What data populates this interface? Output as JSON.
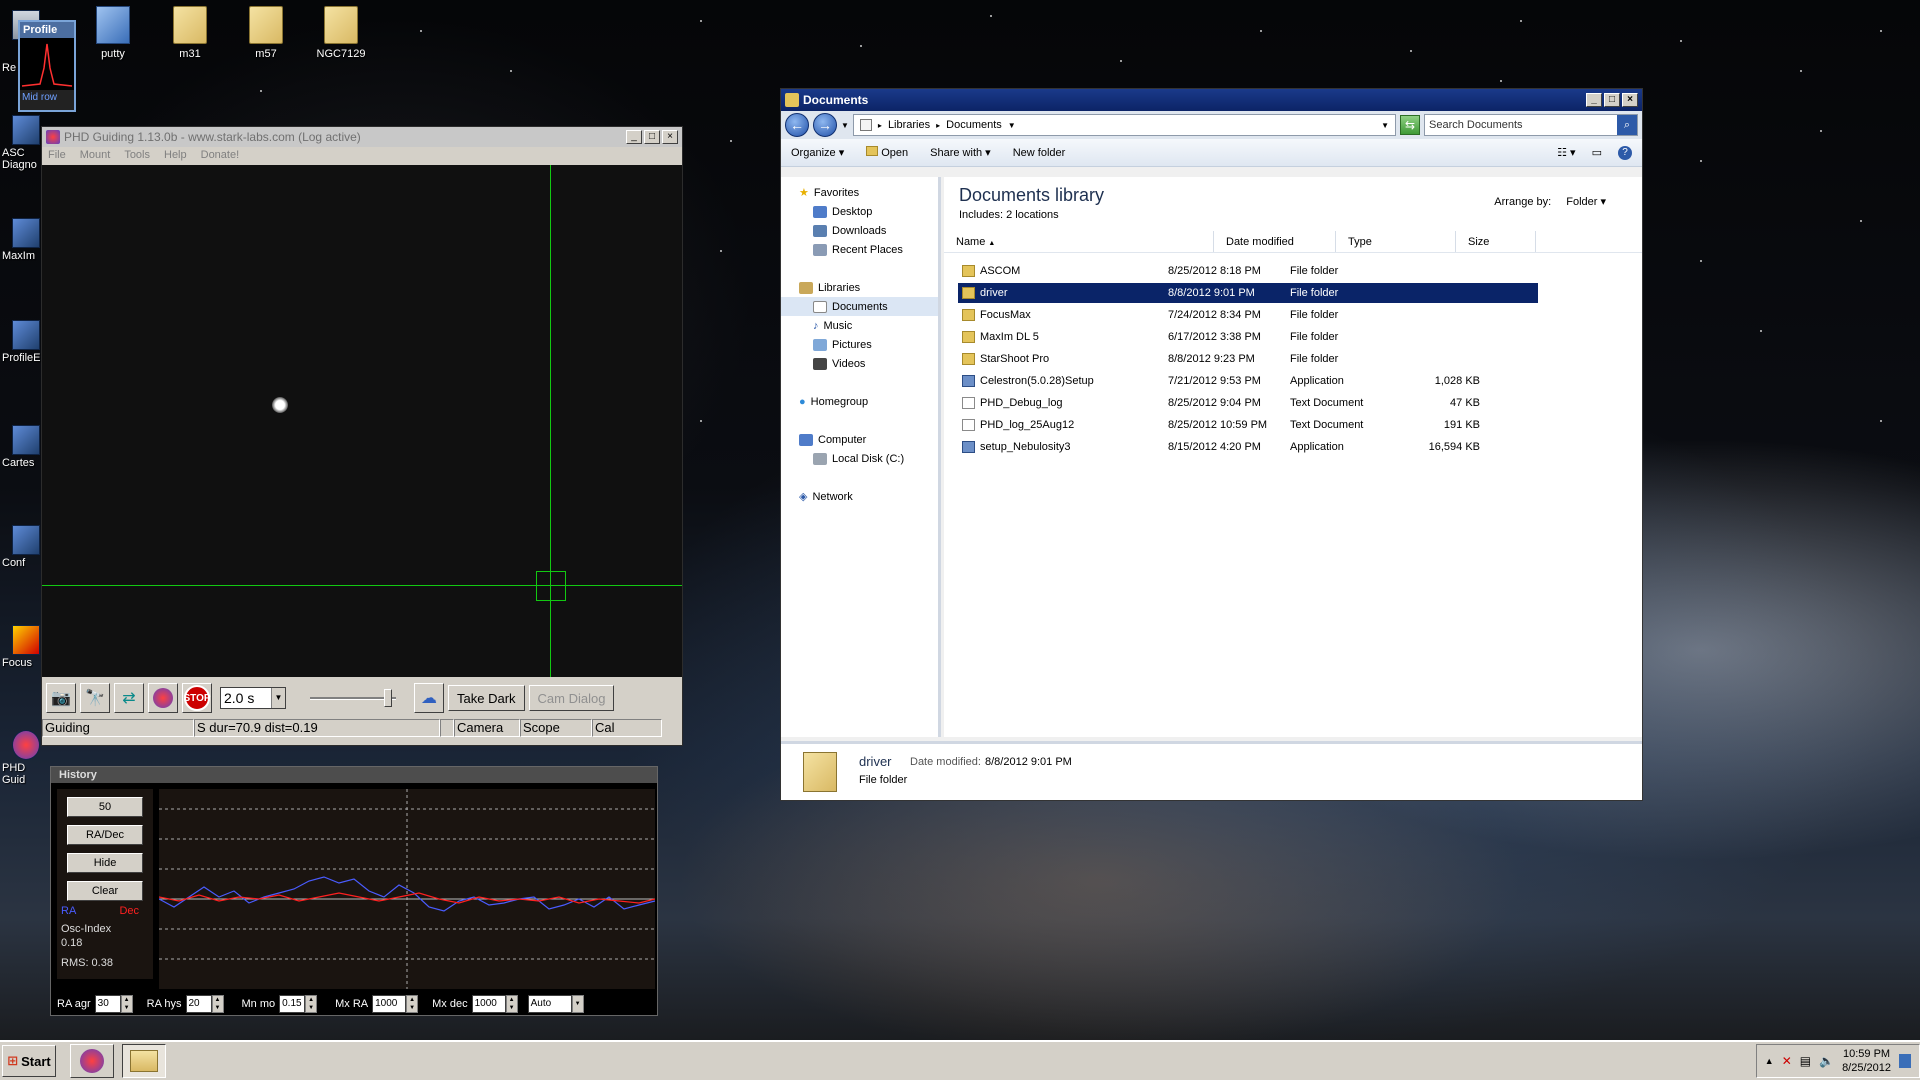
{
  "desktop": {
    "top_icons": [
      {
        "label": "putty",
        "icon": "computer-network-icon"
      },
      {
        "label": "m31",
        "icon": "folder-icon"
      },
      {
        "label": "m57",
        "icon": "folder-icon"
      },
      {
        "label": "NGC7129",
        "icon": "folder-icon"
      }
    ],
    "left_icons": [
      {
        "label": "Re"
      },
      {
        "label": "ASC\nDiagno"
      },
      {
        "label": "MaxIm"
      },
      {
        "label": "ProfileE"
      },
      {
        "label": "Cartes"
      },
      {
        "label": "Conf"
      },
      {
        "label": "Focus"
      },
      {
        "label": "PHD Guid"
      }
    ],
    "profile_widget": {
      "title": "Profile",
      "footer": "Mid row"
    }
  },
  "phd": {
    "title": "PHD Guiding 1.13.0b  -  www.stark-labs.com (Log active)",
    "menu": [
      "File",
      "Mount",
      "Tools",
      "Help",
      "Donate!"
    ],
    "exposure": "2.0 s",
    "take_dark": "Take Dark",
    "cam_dialog": "Cam Dialog",
    "status": {
      "state": "Guiding",
      "info": "S dur=70.9 dist=0.19",
      "camera": "Camera",
      "scope": "Scope",
      "cal": "Cal"
    }
  },
  "history": {
    "title": "History",
    "buttons": [
      "50",
      "RA/Dec",
      "Hide",
      "Clear"
    ],
    "legend_ra": "RA",
    "legend_dec": "Dec",
    "osc_label": "Osc-Index",
    "osc_value": "0.18",
    "rms": "RMS: 0.38",
    "colors": {
      "ra": "#4a5cff",
      "dec": "#ff2020"
    },
    "params": [
      {
        "label": "RA agr",
        "value": "30"
      },
      {
        "label": "RA hys",
        "value": "20"
      },
      {
        "label": "Mn mo",
        "value": "0.15"
      },
      {
        "label": "Mx RA",
        "value": "1000"
      },
      {
        "label": "Mx dec",
        "value": "1000"
      }
    ],
    "dec_mode": "Auto"
  },
  "explorer": {
    "title": "Documents",
    "breadcrumb": [
      "Libraries",
      "Documents"
    ],
    "search_placeholder": "Search Documents",
    "commands": [
      "Organize",
      "Open",
      "Share with",
      "New folder"
    ],
    "nav": {
      "favorites": "Favorites",
      "favorites_items": [
        "Desktop",
        "Downloads",
        "Recent Places"
      ],
      "libraries": "Libraries",
      "libraries_items": [
        "Documents",
        "Music",
        "Pictures",
        "Videos"
      ],
      "homegroup": "Homegroup",
      "computer": "Computer",
      "computer_items": [
        "Local Disk (C:)"
      ],
      "network": "Network"
    },
    "library_title": "Documents library",
    "includes": "Includes:  2 locations",
    "arrange_label": "Arrange by:",
    "arrange_value": "Folder",
    "columns": [
      "Name",
      "Date modified",
      "Type",
      "Size"
    ],
    "files": [
      {
        "name": "ASCOM",
        "date": "8/25/2012 8:18 PM",
        "type": "File folder",
        "size": "",
        "kind": "folder"
      },
      {
        "name": "driver",
        "date": "8/8/2012 9:01 PM",
        "type": "File folder",
        "size": "",
        "kind": "folder",
        "selected": true
      },
      {
        "name": "FocusMax",
        "date": "7/24/2012 8:34 PM",
        "type": "File folder",
        "size": "",
        "kind": "folder"
      },
      {
        "name": "MaxIm DL 5",
        "date": "6/17/2012 3:38 PM",
        "type": "File folder",
        "size": "",
        "kind": "folder"
      },
      {
        "name": "StarShoot Pro",
        "date": "8/8/2012 9:23 PM",
        "type": "File folder",
        "size": "",
        "kind": "folder"
      },
      {
        "name": "Celestron(5.0.28)Setup",
        "date": "7/21/2012 9:53 PM",
        "type": "Application",
        "size": "1,028 KB",
        "kind": "app"
      },
      {
        "name": "PHD_Debug_log",
        "date": "8/25/2012 9:04 PM",
        "type": "Text Document",
        "size": "47 KB",
        "kind": "text"
      },
      {
        "name": "PHD_log_25Aug12",
        "date": "8/25/2012 10:59 PM",
        "type": "Text Document",
        "size": "191 KB",
        "kind": "text"
      },
      {
        "name": "setup_Nebulosity3",
        "date": "8/15/2012 4:20 PM",
        "type": "Application",
        "size": "16,594 KB",
        "kind": "app"
      }
    ],
    "details": {
      "name": "driver",
      "date_label": "Date modified:",
      "date": "8/8/2012 9:01 PM",
      "type": "File folder"
    }
  },
  "taskbar": {
    "start": "Start",
    "time": "10:59 PM",
    "date": "8/25/2012"
  }
}
